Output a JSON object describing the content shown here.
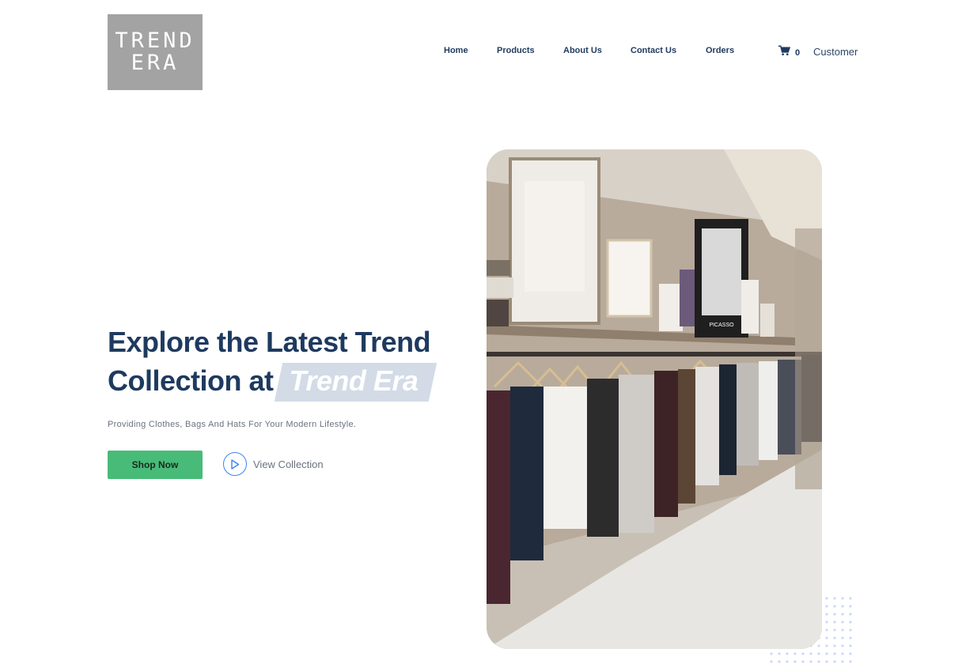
{
  "brand": {
    "logo_line1": "TREND",
    "logo_line2": "ERA"
  },
  "nav": {
    "home": "Home",
    "products": "Products",
    "about": "About Us",
    "contact": "Contact Us",
    "orders": "Orders"
  },
  "cart": {
    "count": "0",
    "icon": "shopping-cart-icon"
  },
  "account": {
    "label": "Customer"
  },
  "hero": {
    "title_part1": "Explore the Latest Trend Collection at",
    "title_brand": "Trend Era",
    "subtitle": "Providing Clothes, Bags And Hats For Your Modern Lifestyle.",
    "primary_cta": "Shop Now",
    "secondary_cta": "View Collection",
    "image_label_picasso": "PICASSO"
  },
  "colors": {
    "primary_navy": "#1e3a5f",
    "accent_green": "#48bb78",
    "accent_blue": "#3b82f6",
    "logo_gray": "#a3a3a3"
  }
}
